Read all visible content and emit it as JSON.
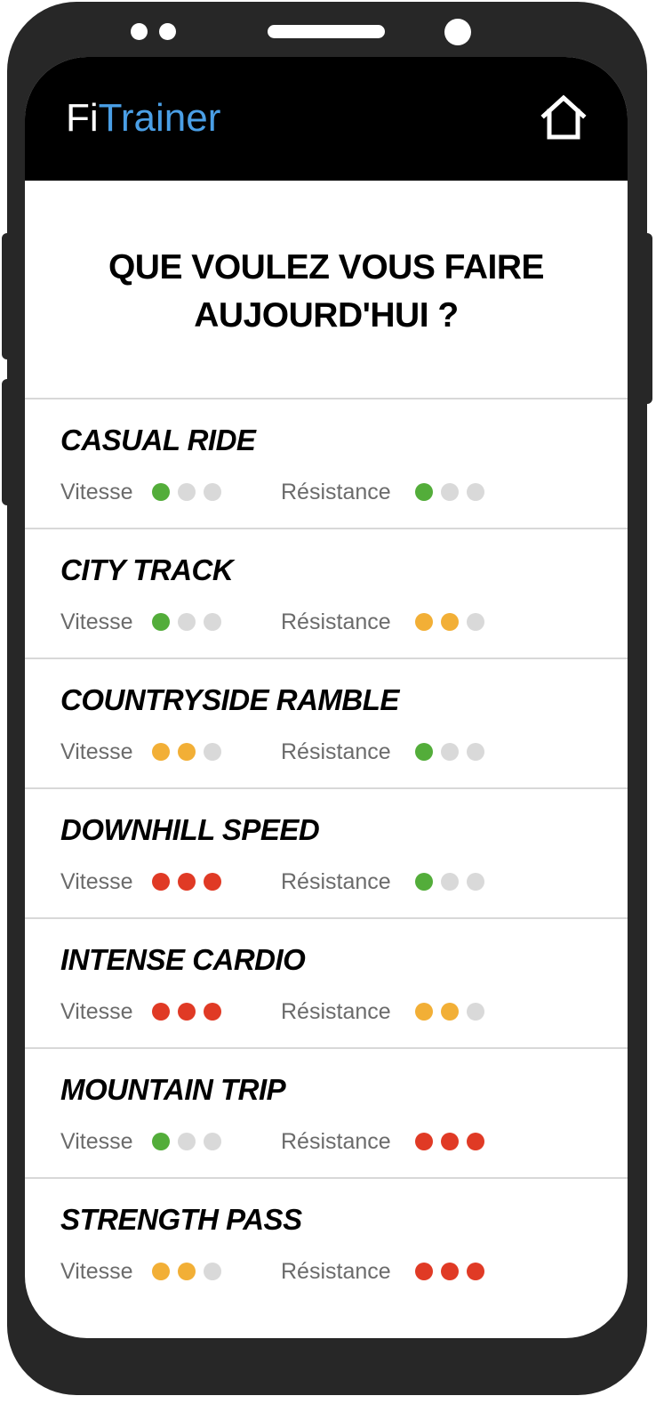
{
  "app": {
    "logo_part1": "Fi",
    "logo_part2": "Trainer",
    "home_icon": "home-icon"
  },
  "page": {
    "title_line1": "QUE VOULEZ VOUS FAIRE",
    "title_line2": "AUJOURD'HUI ?"
  },
  "labels": {
    "speed": "Vitesse",
    "resistance": "Résistance"
  },
  "colors": {
    "low": "#53ad3a",
    "medium": "#f2af36",
    "high": "#e03a25",
    "empty": "#d9d9d9",
    "accent": "#4a9fe6"
  },
  "workouts": [
    {
      "name": "CASUAL RIDE",
      "speed": 1,
      "resistance": 1
    },
    {
      "name": "CITY TRACK",
      "speed": 1,
      "resistance": 2
    },
    {
      "name": "COUNTRYSIDE RAMBLE",
      "speed": 2,
      "resistance": 1
    },
    {
      "name": "DOWNHILL SPEED",
      "speed": 3,
      "resistance": 1
    },
    {
      "name": "INTENSE CARDIO",
      "speed": 3,
      "resistance": 2
    },
    {
      "name": "MOUNTAIN TRIP",
      "speed": 1,
      "resistance": 3
    },
    {
      "name": "STRENGTH PASS",
      "speed": 2,
      "resistance": 3
    }
  ],
  "max_level": 3
}
